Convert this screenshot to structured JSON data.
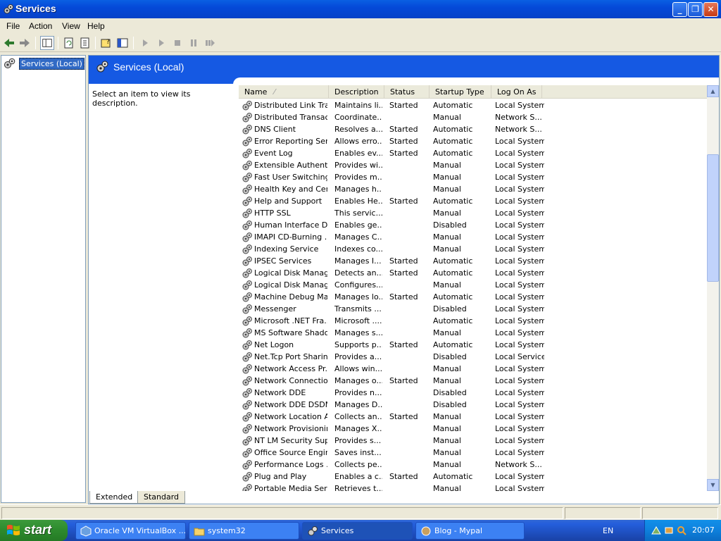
{
  "window": {
    "title": "Services"
  },
  "menu": [
    "File",
    "Action",
    "View",
    "Help"
  ],
  "tree": {
    "root_label": "Services (Local)"
  },
  "panel": {
    "title": "Services (Local)",
    "description_prompt": "Select an item to view its description."
  },
  "columns": {
    "name": "Name",
    "description": "Description",
    "status": "Status",
    "startup_type": "Startup Type",
    "log_on_as": "Log On As"
  },
  "rows": [
    {
      "name": "Distributed Link Tra...",
      "description": "Maintains li...",
      "status": "Started",
      "startup": "Automatic",
      "logon": "Local System"
    },
    {
      "name": "Distributed Transac...",
      "description": "Coordinate...",
      "status": "",
      "startup": "Manual",
      "logon": "Network S..."
    },
    {
      "name": "DNS Client",
      "description": "Resolves a...",
      "status": "Started",
      "startup": "Automatic",
      "logon": "Network S..."
    },
    {
      "name": "Error Reporting Ser...",
      "description": "Allows erro...",
      "status": "Started",
      "startup": "Automatic",
      "logon": "Local System"
    },
    {
      "name": "Event Log",
      "description": "Enables ev...",
      "status": "Started",
      "startup": "Automatic",
      "logon": "Local System"
    },
    {
      "name": "Extensible Authenti...",
      "description": "Provides wi...",
      "status": "",
      "startup": "Manual",
      "logon": "Local System"
    },
    {
      "name": "Fast User Switching...",
      "description": "Provides m...",
      "status": "",
      "startup": "Manual",
      "logon": "Local System"
    },
    {
      "name": "Health Key and Cer...",
      "description": "Manages h...",
      "status": "",
      "startup": "Manual",
      "logon": "Local System"
    },
    {
      "name": "Help and Support",
      "description": "Enables He...",
      "status": "Started",
      "startup": "Automatic",
      "logon": "Local System"
    },
    {
      "name": "HTTP SSL",
      "description": "This servic...",
      "status": "",
      "startup": "Manual",
      "logon": "Local System"
    },
    {
      "name": "Human Interface D...",
      "description": "Enables ge...",
      "status": "",
      "startup": "Disabled",
      "logon": "Local System"
    },
    {
      "name": "IMAPI CD-Burning ...",
      "description": "Manages C...",
      "status": "",
      "startup": "Manual",
      "logon": "Local System"
    },
    {
      "name": "Indexing Service",
      "description": "Indexes co...",
      "status": "",
      "startup": "Manual",
      "logon": "Local System"
    },
    {
      "name": "IPSEC Services",
      "description": "Manages I...",
      "status": "Started",
      "startup": "Automatic",
      "logon": "Local System"
    },
    {
      "name": "Logical Disk Manager",
      "description": "Detects an...",
      "status": "Started",
      "startup": "Automatic",
      "logon": "Local System"
    },
    {
      "name": "Logical Disk Manag...",
      "description": "Configures...",
      "status": "",
      "startup": "Manual",
      "logon": "Local System"
    },
    {
      "name": "Machine Debug Ma...",
      "description": "Manages lo...",
      "status": "Started",
      "startup": "Automatic",
      "logon": "Local System"
    },
    {
      "name": "Messenger",
      "description": "Transmits ...",
      "status": "",
      "startup": "Disabled",
      "logon": "Local System"
    },
    {
      "name": "Microsoft .NET Fra...",
      "description": "Microsoft ....",
      "status": "",
      "startup": "Automatic",
      "logon": "Local System"
    },
    {
      "name": "MS Software Shado...",
      "description": "Manages s...",
      "status": "",
      "startup": "Manual",
      "logon": "Local System"
    },
    {
      "name": "Net Logon",
      "description": "Supports p...",
      "status": "Started",
      "startup": "Automatic",
      "logon": "Local System"
    },
    {
      "name": "Net.Tcp Port Sharin...",
      "description": "Provides a...",
      "status": "",
      "startup": "Disabled",
      "logon": "Local Service"
    },
    {
      "name": "Network Access Pr...",
      "description": "Allows win...",
      "status": "",
      "startup": "Manual",
      "logon": "Local System"
    },
    {
      "name": "Network Connections",
      "description": "Manages o...",
      "status": "Started",
      "startup": "Manual",
      "logon": "Local System"
    },
    {
      "name": "Network DDE",
      "description": "Provides n...",
      "status": "",
      "startup": "Disabled",
      "logon": "Local System"
    },
    {
      "name": "Network DDE DSDM",
      "description": "Manages D...",
      "status": "",
      "startup": "Disabled",
      "logon": "Local System"
    },
    {
      "name": "Network Location A...",
      "description": "Collects an...",
      "status": "Started",
      "startup": "Manual",
      "logon": "Local System"
    },
    {
      "name": "Network Provisionin...",
      "description": "Manages X...",
      "status": "",
      "startup": "Manual",
      "logon": "Local System"
    },
    {
      "name": "NT LM Security Sup...",
      "description": "Provides s...",
      "status": "",
      "startup": "Manual",
      "logon": "Local System"
    },
    {
      "name": "Office Source Engine",
      "description": "Saves inst...",
      "status": "",
      "startup": "Manual",
      "logon": "Local System"
    },
    {
      "name": "Performance Logs ...",
      "description": "Collects pe...",
      "status": "",
      "startup": "Manual",
      "logon": "Network S..."
    },
    {
      "name": "Plug and Play",
      "description": "Enables a c...",
      "status": "Started",
      "startup": "Automatic",
      "logon": "Local System"
    },
    {
      "name": "Portable Media Seri...",
      "description": "Retrieves t...",
      "status": "",
      "startup": "Manual",
      "logon": "Local System"
    }
  ],
  "tabs": [
    "Extended",
    "Standard"
  ],
  "taskbar": {
    "start_label": "start",
    "tasks": [
      "Oracle VM VirtualBox ...",
      "system32",
      "Services",
      "Blog - Mypal"
    ],
    "language": "EN",
    "clock": "20:07"
  },
  "colors": {
    "titlebar": "#0549d8",
    "header_band": "#1559e3",
    "selection": "#316ac5",
    "taskbar": "#245edb",
    "start": "#2d8a2d"
  }
}
